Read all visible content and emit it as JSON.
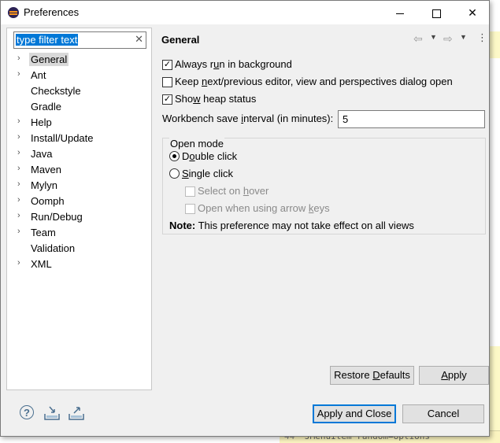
{
  "window": {
    "title": "Preferences",
    "minimize_glyph": "",
    "maximize_glyph": "",
    "close_glyph": "✕"
  },
  "filter": {
    "text": "type filter text",
    "clear_glyph": "✕"
  },
  "tree": {
    "items": [
      {
        "label": "General",
        "expandable": true,
        "selected": true
      },
      {
        "label": "Ant",
        "expandable": true
      },
      {
        "label": "Checkstyle",
        "expandable": false
      },
      {
        "label": "Gradle",
        "expandable": false
      },
      {
        "label": "Help",
        "expandable": true
      },
      {
        "label": "Install/Update",
        "expandable": true
      },
      {
        "label": "Java",
        "expandable": true
      },
      {
        "label": "Maven",
        "expandable": true
      },
      {
        "label": "Mylyn",
        "expandable": true
      },
      {
        "label": "Oomph",
        "expandable": true
      },
      {
        "label": "Run/Debug",
        "expandable": true
      },
      {
        "label": "Team",
        "expandable": true
      },
      {
        "label": "Validation",
        "expandable": false
      },
      {
        "label": "XML",
        "expandable": true
      }
    ]
  },
  "page": {
    "title": "General",
    "nav_back_glyph": "⇦",
    "nav_forward_glyph": "⇨",
    "dropdown_glyph": "▼",
    "menu_glyph": "⋮"
  },
  "options": {
    "always_run_bg": {
      "pre": "Always r",
      "mn": "u",
      "post": "n in background",
      "checked": true
    },
    "keep_next_prev": {
      "pre": "Keep ",
      "mn": "n",
      "post": "ext/previous editor, view and perspectives dialog open",
      "checked": false
    },
    "show_heap": {
      "pre": "Sho",
      "mn": "w",
      "post": " heap status",
      "checked": true
    },
    "interval_label": {
      "pre": "Workbench save ",
      "mn": "i",
      "post": "nterval (in minutes):"
    },
    "interval_value": "5"
  },
  "open_mode": {
    "title": "Open mode",
    "double_click": {
      "pre": "D",
      "mn": "o",
      "post": "uble click",
      "selected": true
    },
    "single_click": {
      "pre": "",
      "mn": "S",
      "post": "ingle click",
      "selected": false
    },
    "select_on_hover": {
      "pre": "Select on ",
      "mn": "h",
      "post": "over",
      "checked": false,
      "enabled": false
    },
    "open_arrow_keys": {
      "pre": "Open when using arrow ",
      "mn": "k",
      "post": "eys",
      "checked": false,
      "enabled": false
    },
    "note_bold": "Note:",
    "note_text": " This preference may not take effect on all views"
  },
  "buttons": {
    "restore": {
      "pre": "Restore ",
      "mn": "D",
      "post": "efaults"
    },
    "apply": {
      "pre": "",
      "mn": "A",
      "post": "pply"
    },
    "apply_close": "Apply and Close",
    "cancel": "Cancel"
  },
  "footer": {
    "help_glyph": "?"
  },
  "background_editor": {
    "line_number": "44",
    "code_text": "JMenuItem random=options"
  }
}
